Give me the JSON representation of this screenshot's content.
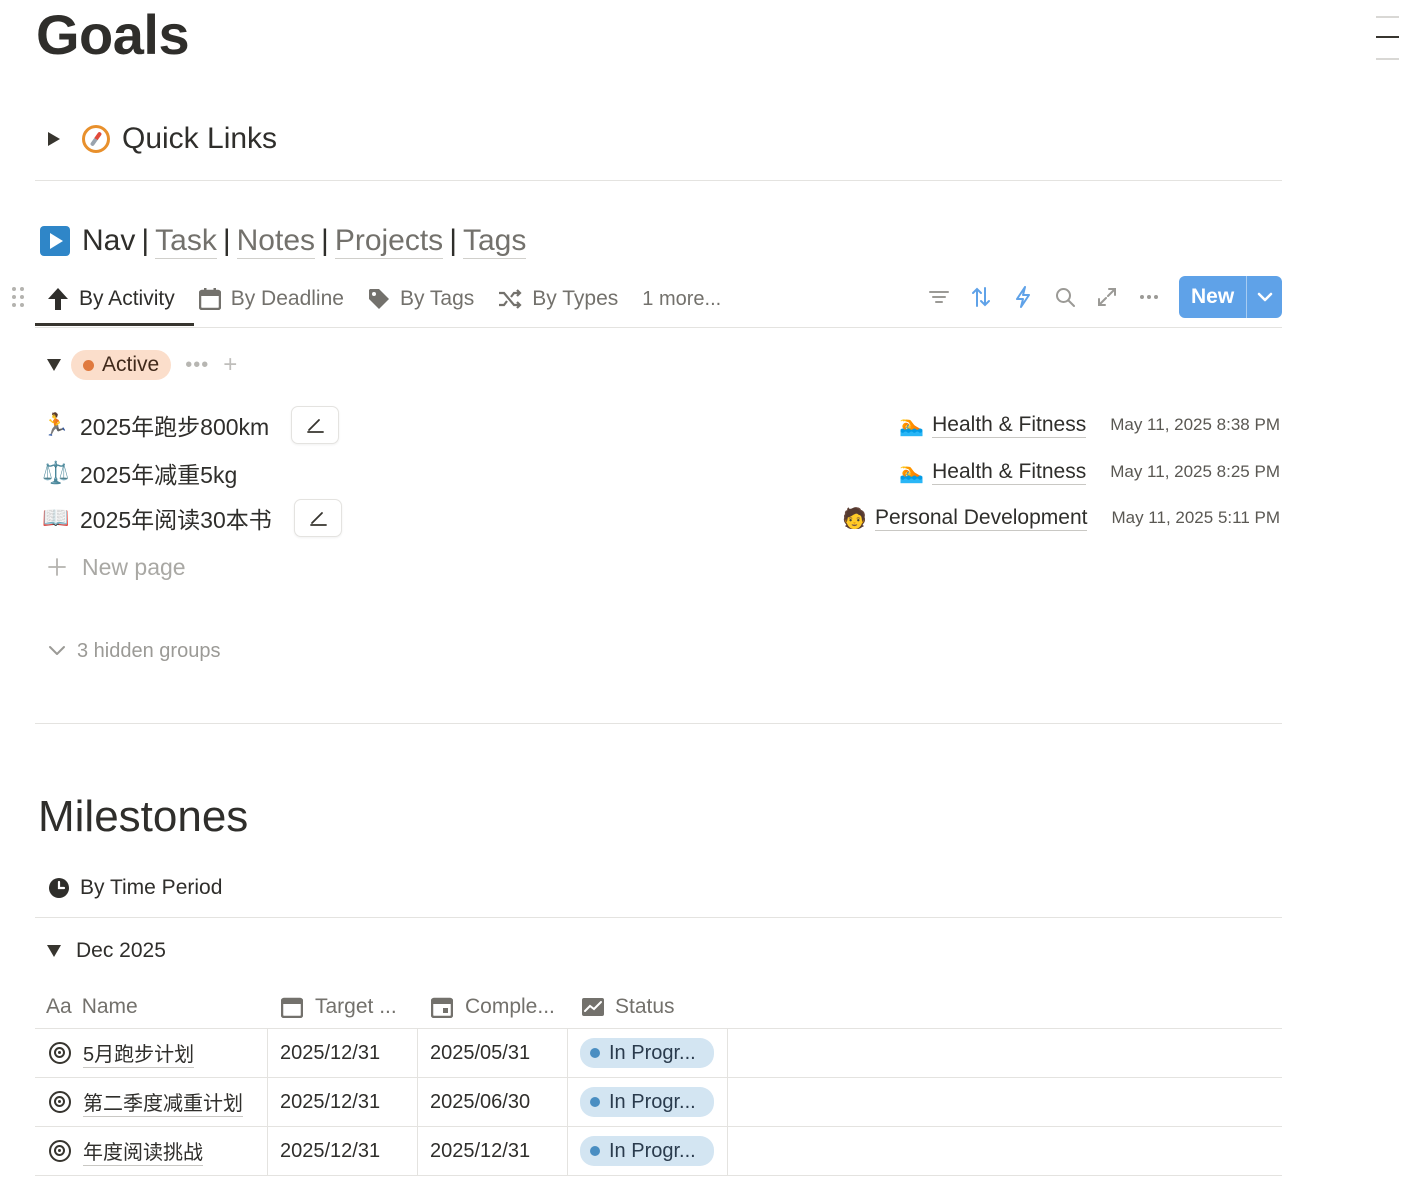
{
  "page": {
    "title": "Goals"
  },
  "quick_links": {
    "label": "Quick Links",
    "icon": "compass-icon"
  },
  "nav": {
    "prefix": "Nav",
    "links": [
      "Task",
      "Notes",
      "Projects",
      "Tags"
    ],
    "separator": "|"
  },
  "views": {
    "tabs": [
      {
        "label": "By Activity",
        "icon": "arrow-up-icon",
        "active": true
      },
      {
        "label": "By Deadline",
        "icon": "calendar-icon",
        "active": false
      },
      {
        "label": "By Tags",
        "icon": "tag-icon",
        "active": false
      },
      {
        "label": "By Types",
        "icon": "shuffle-icon",
        "active": false
      }
    ],
    "more": "1 more...",
    "new_label": "New"
  },
  "active_group": {
    "label": "Active",
    "items": [
      {
        "icon": "🏃",
        "title": "2025年跑步800km",
        "tag_emoji": "🏊",
        "tag": "Health & Fitness",
        "date": "May 11, 2025 8:38 PM"
      },
      {
        "icon": "⚖️",
        "title": "2025年减重5kg",
        "tag_emoji": "🏊",
        "tag": "Health & Fitness",
        "date": "May 11, 2025 8:25 PM"
      },
      {
        "icon": "📖",
        "title": "2025年阅读30本书",
        "tag_emoji": "🧑",
        "tag": "Personal Development",
        "date": "May 11, 2025 5:11 PM"
      }
    ],
    "new_page": "New page",
    "hidden_groups": "3 hidden groups"
  },
  "milestones": {
    "title": "Milestones",
    "view_tab": "By Time Period",
    "group": "Dec 2025",
    "columns": {
      "name": "Name",
      "name_prefix": "Aa",
      "target": "Target ...",
      "complete": "Comple...",
      "status": "Status"
    },
    "rows": [
      {
        "name": "5月跑步计划",
        "target": "2025/12/31",
        "complete": "2025/05/31",
        "status": "In Progr..."
      },
      {
        "name": "第二季度减重计划",
        "target": "2025/12/31",
        "complete": "2025/06/30",
        "status": "In Progr..."
      },
      {
        "name": "年度阅读挑战",
        "target": "2025/12/31",
        "complete": "2025/12/31",
        "status": "In Progr..."
      }
    ]
  },
  "colors": {
    "accent": "#5fa2e8",
    "active_pill": "#fbdecb",
    "active_dot": "#e07a3f",
    "status_pill": "#d3e5f2",
    "status_dot": "#4a8ec2"
  }
}
